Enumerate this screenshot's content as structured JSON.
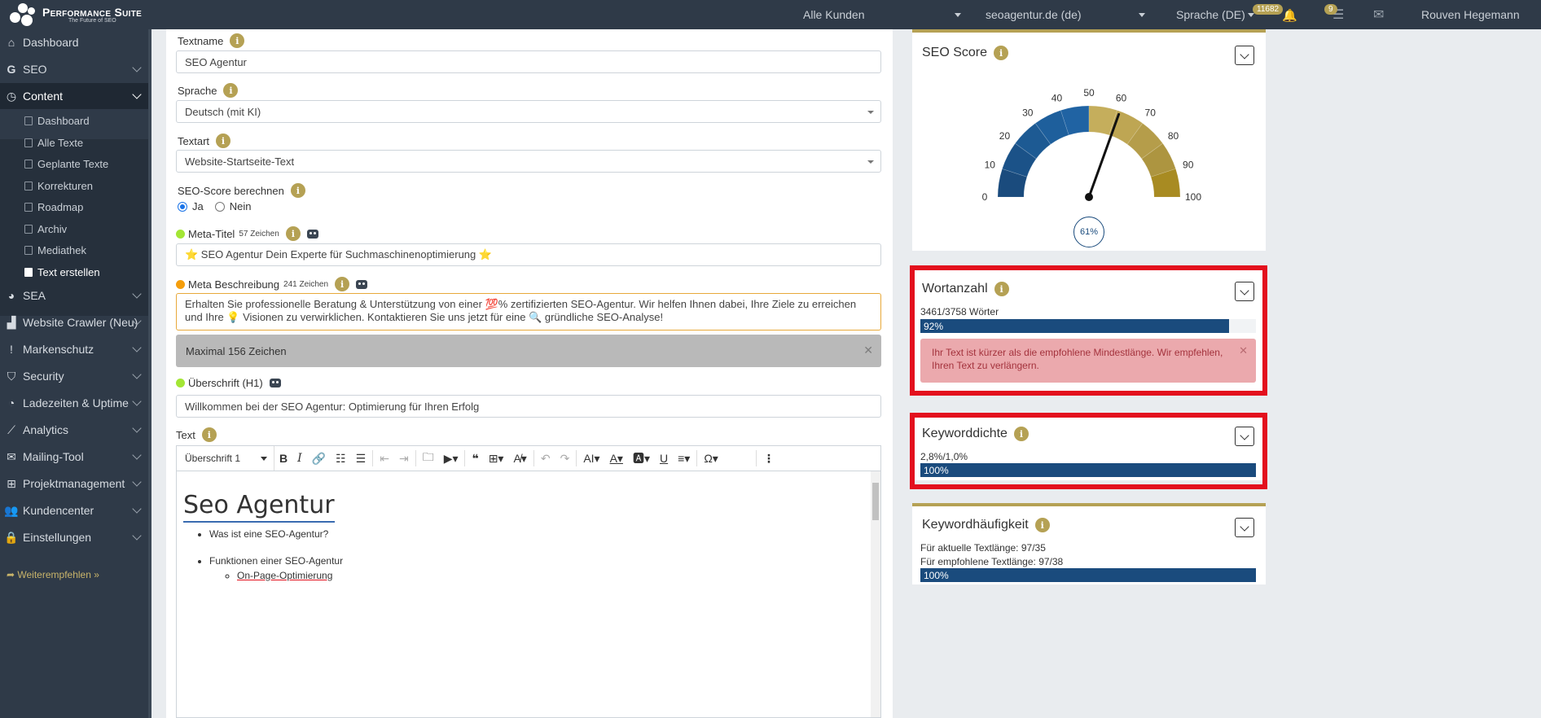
{
  "topbar": {
    "brand": "Performance Suite",
    "tagline": "The Future of SEO",
    "customer_select": "Alle Kunden",
    "domain_select": "seoagentur.de (de)",
    "language_select": "Sprache (DE)",
    "notif_count": "11682",
    "task_count": "9",
    "user": "Rouven Hegemann"
  },
  "sidebar": {
    "items": [
      {
        "label": "Dashboard"
      },
      {
        "label": "SEO"
      },
      {
        "label": "Content"
      },
      {
        "label": "SEA"
      },
      {
        "label": "Website Crawler (Neu)"
      },
      {
        "label": "Markenschutz"
      },
      {
        "label": "Security"
      },
      {
        "label": "Ladezeiten & Uptime"
      },
      {
        "label": "Analytics"
      },
      {
        "label": "Mailing-Tool"
      },
      {
        "label": "Projektmanagement"
      },
      {
        "label": "Kundencenter"
      },
      {
        "label": "Einstellungen"
      }
    ],
    "content_sub": [
      "Dashboard",
      "Alle Texte",
      "Geplante Texte",
      "Korrekturen",
      "Roadmap",
      "Archiv",
      "Mediathek",
      "Text erstellen"
    ],
    "recommend": "Weiterempfehlen »"
  },
  "form": {
    "textname_label": "Textname",
    "textname_value": "SEO Agentur",
    "sprache_label": "Sprache",
    "sprache_value": "Deutsch (mit KI)",
    "textart_label": "Textart",
    "textart_value": "Website-Startseite-Text",
    "seoscore_label": "SEO-Score berechnen",
    "radio_yes": "Ja",
    "radio_no": "Nein",
    "metatitle_label": "Meta-Titel",
    "metatitle_count": "57 Zeichen",
    "metatitle_value": "⭐ SEO Agentur Dein Experte für Suchmaschinenoptimierung ⭐",
    "metadesc_label": "Meta Beschreibung",
    "metadesc_count": "241 Zeichen",
    "metadesc_value": "Erhalten Sie professionelle Beratung & Unterstützung von einer 💯% zertifizierten SEO-Agentur. Wir helfen Ihnen dabei, Ihre Ziele zu erreichen und Ihre 💡 Visionen zu verwirklichen. Kontaktieren Sie uns jetzt für eine 🔍 gründliche SEO-Analyse!",
    "metadesc_warning": "Maximal 156 Zeichen",
    "h1_label": "Überschrift (H1)",
    "h1_value": "Willkommen bei der SEO Agentur: Optimierung für Ihren Erfolg",
    "text_label": "Text"
  },
  "editor": {
    "block_style": "Überschrift 1",
    "heading": "Seo Agentur",
    "bullets": [
      "Was ist eine SEO-Agentur?",
      "Funktionen einer SEO-Agentur"
    ],
    "sub_bullets": [
      "On-Page-Optimierung"
    ]
  },
  "seo_score": {
    "title": "SEO Score",
    "value": 61,
    "value_label": "61%",
    "ticks": [
      "0",
      "10",
      "20",
      "30",
      "40",
      "50",
      "60",
      "70",
      "80",
      "90",
      "100"
    ]
  },
  "wortanzahl": {
    "title": "Wortanzahl",
    "meta": "3461/3758 Wörter",
    "progress": 92,
    "progress_label": "92%",
    "alert": "Ihr Text ist kürzer als die empfohlene Mindestlänge. Wir empfehlen, Ihren Text zu verlängern."
  },
  "keyworddichte": {
    "title": "Keyworddichte",
    "meta": "2,8%/1,0%",
    "progress": 100,
    "progress_label": "100%"
  },
  "keywordhaeufigkeit": {
    "title": "Keywordhäufigkeit",
    "meta1": "Für aktuelle Textlänge: 97/35",
    "meta2": "Für empfohlene Textlänge: 97/38",
    "progress": 100,
    "progress_label": "100%"
  },
  "colors": {
    "sidebar": "#2f3a48",
    "gold": "#b5a154",
    "blue": "#1a4b7d",
    "highlight": "#e3101d"
  }
}
